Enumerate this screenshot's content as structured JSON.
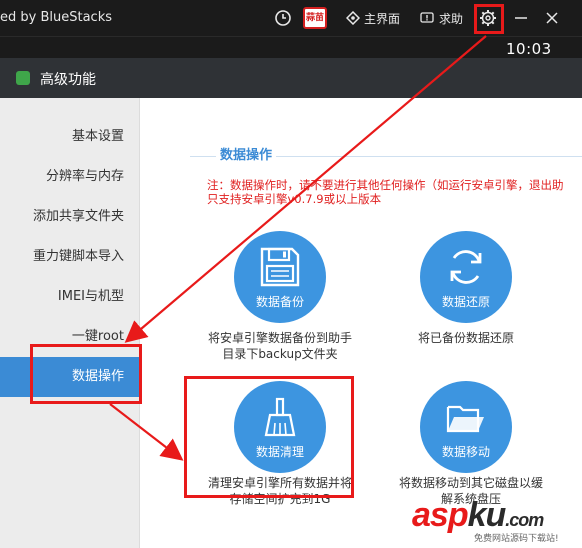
{
  "titlebar": {
    "app_title": "ed by BlueStacks",
    "home_label": "主界面",
    "help_label": "求助",
    "brand_badge": "蒜苗"
  },
  "clock": "10:03",
  "dialog": {
    "title": "高级功能"
  },
  "sidebar": {
    "items": [
      {
        "label": "基本设置"
      },
      {
        "label": "分辨率与内存"
      },
      {
        "label": "添加共享文件夹"
      },
      {
        "label": "重力键脚本导入"
      },
      {
        "label": "IMEI与机型"
      },
      {
        "label": "一键root"
      },
      {
        "label": "数据操作"
      }
    ]
  },
  "main": {
    "section_title": "数据操作",
    "notice_line1": "注：数据操作时，请不要进行其他任何操作（如运行安卓引擎，退出助",
    "notice_line2": "只支持安卓引擎v0.7.9或以上版本",
    "actions": [
      {
        "label": "数据备份",
        "desc1": "将安卓引擎数据备份到助手",
        "desc2": "目录下backup文件夹"
      },
      {
        "label": "数据还原",
        "desc1": "将已备份数据还原",
        "desc2": ""
      },
      {
        "label": "数据清理",
        "desc1": "清理安卓引擎所有数据并将",
        "desc2": "存储空间扩充到1G"
      },
      {
        "label": "数据移动",
        "desc1": "将数据移动到其它磁盘以缓",
        "desc2": "解系统盘压"
      }
    ]
  },
  "watermark": {
    "main_a": "asp",
    "main_b": "ku",
    "main_c": ".com",
    "sub": "免费网站源码下载站!"
  },
  "colors": {
    "accent": "#3b8bd5",
    "circle": "#3d95e0",
    "annotation": "#e81a1a"
  }
}
